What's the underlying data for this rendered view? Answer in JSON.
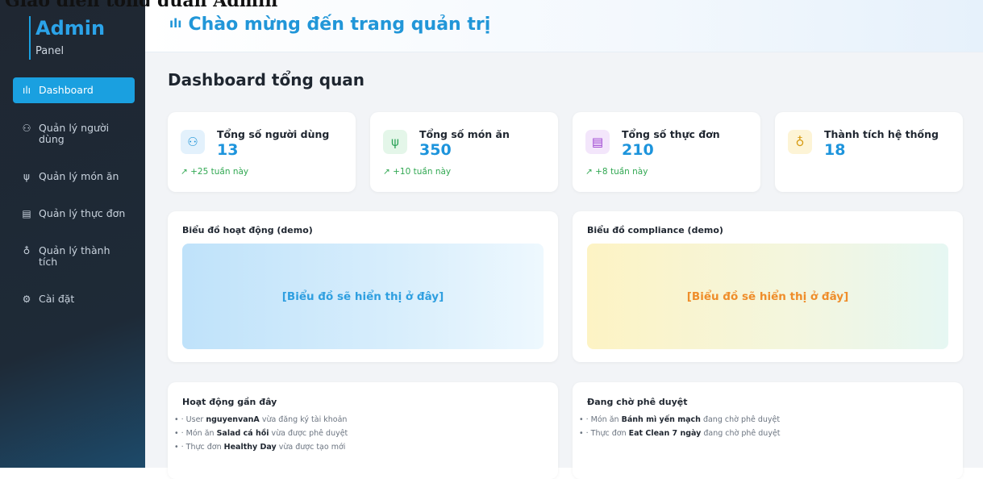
{
  "top_fragment": "Giao diện tổng quan Admin",
  "brand": {
    "title": "Admin",
    "subtitle": "Panel"
  },
  "sidebar": {
    "items": [
      {
        "label": "Dashboard",
        "icon": "bar-chart-icon",
        "glyph": "ılı",
        "active": true
      },
      {
        "label": "Quản lý người dùng",
        "icon": "users-icon",
        "glyph": "⚇",
        "active": false
      },
      {
        "label": "Quản lý món ăn",
        "icon": "utensils-icon",
        "glyph": "ψ",
        "active": false
      },
      {
        "label": "Quản lý thực đơn",
        "icon": "clipboard-icon",
        "glyph": "▤",
        "active": false
      },
      {
        "label": "Quản lý thành tích",
        "icon": "award-icon",
        "glyph": "♁",
        "active": false
      },
      {
        "label": "Cài đặt",
        "icon": "gear-icon",
        "glyph": "⚙",
        "active": false
      }
    ]
  },
  "header": {
    "title": "Chào mừng đến trang quản trị",
    "icon": "bar-chart-icon",
    "glyph": "ılı"
  },
  "main": {
    "page_title": "Dashboard tổng quan",
    "stats": [
      {
        "label": "Tổng số người dùng",
        "value": "13",
        "delta": "↗ +25 tuần này",
        "icon": "users-icon",
        "glyph": "⚇",
        "icon_bg": "#e3f1fc",
        "icon_color": "#2196d8"
      },
      {
        "label": "Tổng số món ăn",
        "value": "350",
        "delta": "↗ +10 tuần này",
        "icon": "utensils-icon",
        "glyph": "ψ",
        "icon_bg": "#e4f6e9",
        "icon_color": "#2fa35a"
      },
      {
        "label": "Tổng số thực đơn",
        "value": "210",
        "delta": "↗ +8 tuần này",
        "icon": "clipboard-icon",
        "glyph": "▤",
        "icon_bg": "#f3e6fb",
        "icon_color": "#9b3fd0"
      },
      {
        "label": "Thành tích hệ thống",
        "value": "18",
        "delta": "",
        "icon": "award-icon",
        "glyph": "♁",
        "icon_bg": "#fdf4d6",
        "icon_color": "#d79b12"
      }
    ],
    "charts": [
      {
        "title": "Biểu đồ hoạt động (demo)",
        "placeholder": "[Biểu đồ sẽ hiển thị ở đây]",
        "color": "#2f9fe0"
      },
      {
        "title": "Biểu đồ compliance (demo)",
        "placeholder": "[Biểu đồ sẽ hiển thị ở đây]",
        "color": "#ef8d2a"
      }
    ],
    "recent": {
      "title": "Hoạt động gần đây",
      "items": [
        {
          "pre": "• · User ",
          "bold": "nguyenvanA",
          "post": " vừa đăng ký tài khoản"
        },
        {
          "pre": "• · Món ăn ",
          "bold": "Salad cá hồi",
          "post": " vừa được phê duyệt"
        },
        {
          "pre": "• · Thực đơn ",
          "bold": "Healthy Day",
          "post": " vừa được tạo mới"
        }
      ]
    },
    "pending": {
      "title": "Đang chờ phê duyệt",
      "items": [
        {
          "pre": "• · Món ăn ",
          "bold": "Bánh mì yến mạch",
          "post": " đang chờ phê duyệt"
        },
        {
          "pre": "• · Thực đơn ",
          "bold": "Eat Clean 7 ngày",
          "post": " đang chờ phê duyệt"
        }
      ]
    }
  }
}
